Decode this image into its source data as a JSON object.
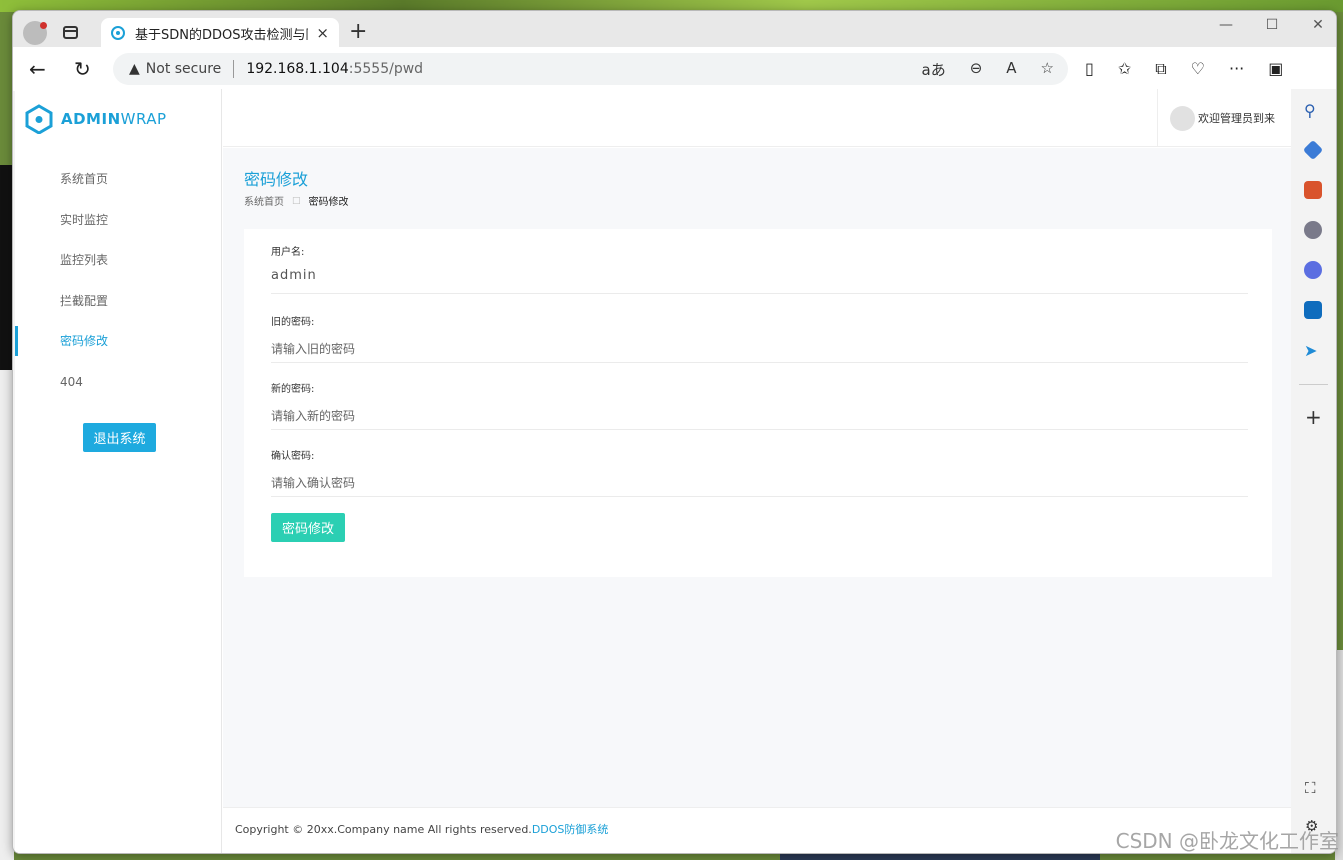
{
  "browser": {
    "tab_title": "基于SDN的DDOS攻击检测与防御",
    "not_secure": "Not secure",
    "url_host": "192.168.1.104",
    "url_rest": ":5555/pwd",
    "new_tab": "+",
    "close_tab": "×"
  },
  "app": {
    "logo_bold": "ADMIN",
    "logo_light": "WRAP",
    "welcome": "欢迎管理员到来",
    "accent": "#1ba0d7"
  },
  "sidebar": {
    "items": [
      {
        "label": "系统首页"
      },
      {
        "label": "实时监控"
      },
      {
        "label": "监控列表"
      },
      {
        "label": "拦截配置"
      },
      {
        "label": "密码修改"
      },
      {
        "label": "404"
      }
    ],
    "logout": "退出系统"
  },
  "main": {
    "title": "密码修改",
    "breadcrumb": {
      "home": "系统首页",
      "current": "密码修改"
    },
    "form": {
      "username_label": "用户名:",
      "username_value": "admin",
      "old_label": "旧的密码:",
      "old_placeholder": "请输入旧的密码",
      "new_label": "新的密码:",
      "new_placeholder": "请输入新的密码",
      "confirm_label": "确认密码:",
      "confirm_placeholder": "请输入确认密码",
      "submit": "密码修改"
    }
  },
  "footer": {
    "text": "Copyright © 20xx.Company name All rights reserved.",
    "link": "DDOS防御系统"
  },
  "watermark": "CSDN @卧龙文化工作室"
}
